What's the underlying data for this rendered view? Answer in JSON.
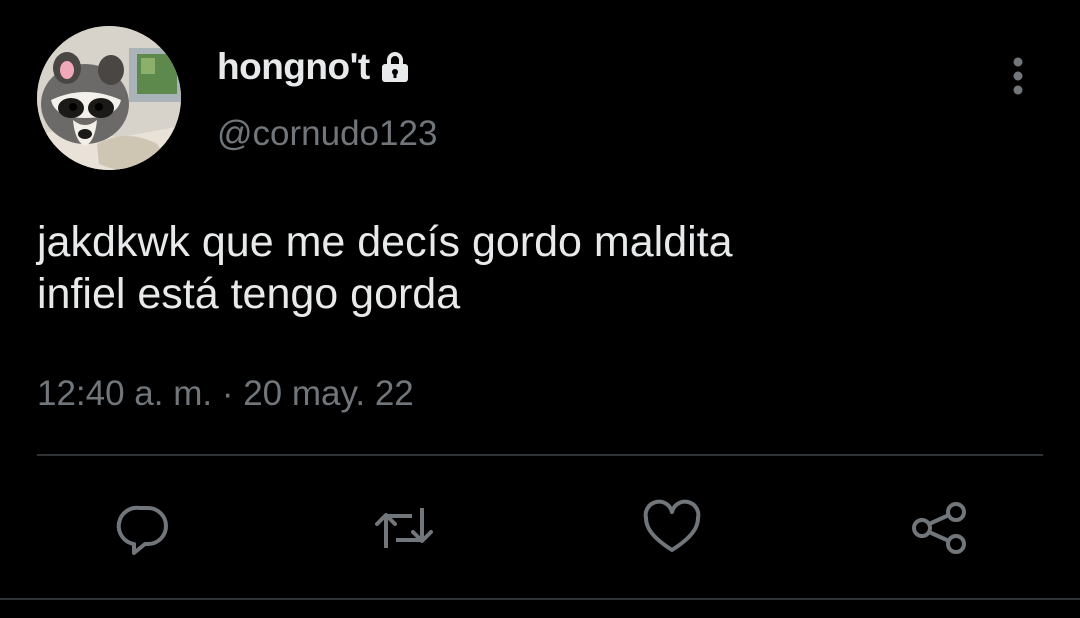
{
  "user": {
    "display_name": "hongno't",
    "handle": "@cornudo123",
    "protected_icon": "lock-icon"
  },
  "tweet": {
    "text": "jakdkwk que me decís gordo maldita\ninfiel está tengo gorda",
    "timestamp": "12:40 a. m. · 20 may. 22"
  },
  "actions": [
    {
      "name": "reply",
      "icon": "reply-icon"
    },
    {
      "name": "retweet",
      "icon": "retweet-icon"
    },
    {
      "name": "like",
      "icon": "heart-icon"
    },
    {
      "name": "share",
      "icon": "share-icon"
    }
  ],
  "colors": {
    "background": "#000000",
    "primary_text": "#e7e9ea",
    "secondary_text": "#71767b",
    "divider": "#2f3336"
  }
}
